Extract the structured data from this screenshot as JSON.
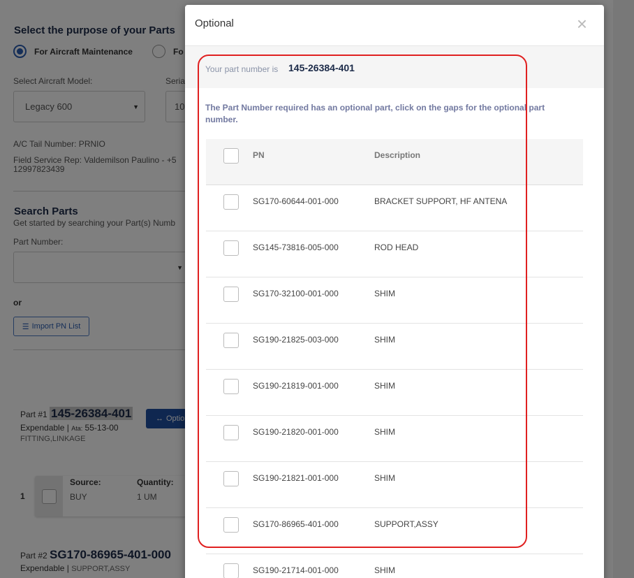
{
  "background": {
    "purpose_title": "Select the purpose of your Parts",
    "radio_maintenance": "For Aircraft Maintenance",
    "radio_other": "Fo",
    "aircraft_model_label": "Select Aircraft Model:",
    "aircraft_model_value": "Legacy 600",
    "serial_label": "Seria",
    "serial_value": "10",
    "tail_number": "A/C Tail Number: PRNIO",
    "field_rep_line1": "Field Service Rep: Valdemilson Paulino - +5",
    "field_rep_line2": "12997823439",
    "search_title": "Search Parts",
    "search_subtitle": "Get started by searching your Part(s) Numb",
    "part_number_label": "Part Number:",
    "or_label": "or",
    "import_button": "Import PN List",
    "part1_prefix": "Part #1",
    "part1_pn": "145-26384-401",
    "part1_type": "Expendable |",
    "part1_ata_label": "Ata:",
    "part1_ata": "55-13-00",
    "part1_desc": "FITTING,LINKAGE",
    "optional_button": "Optio",
    "card_index": "1",
    "card_source_label": "Source:",
    "card_source_value": "BUY",
    "card_quantity_label": "Quantity:",
    "card_quantity_value": "1 UM",
    "part2_prefix": "Part #2",
    "part2_pn": "SG170-86965-401-000",
    "part2_type": "Expendable |",
    "part2_desc": "SUPPORT,ASSY"
  },
  "modal": {
    "title": "Optional",
    "close": "×",
    "pn_label": "Your part number is",
    "pn_value": "145-26384-401",
    "notice": "The Part Number required has an optional part, click on the gaps for the optional part number.",
    "columns": {
      "pn": "PN",
      "description": "Description"
    },
    "rows": [
      {
        "pn": "SG170-60644-001-000",
        "description": "BRACKET SUPPORT, HF ANTENA"
      },
      {
        "pn": "SG145-73816-005-000",
        "description": "ROD HEAD"
      },
      {
        "pn": "SG170-32100-001-000",
        "description": "SHIM"
      },
      {
        "pn": "SG190-21825-003-000",
        "description": "SHIM"
      },
      {
        "pn": "SG190-21819-001-000",
        "description": "SHIM"
      },
      {
        "pn": "SG190-21820-001-000",
        "description": "SHIM"
      },
      {
        "pn": "SG190-21821-001-000",
        "description": "SHIM"
      },
      {
        "pn": "SG170-86965-401-000",
        "description": "SUPPORT,ASSY"
      },
      {
        "pn": "SG190-21714-001-000",
        "description": "SHIM"
      }
    ]
  },
  "colors": {
    "accent": "#2a5db0",
    "title_navy": "#1c2b49",
    "highlight_outline": "#e02020"
  }
}
